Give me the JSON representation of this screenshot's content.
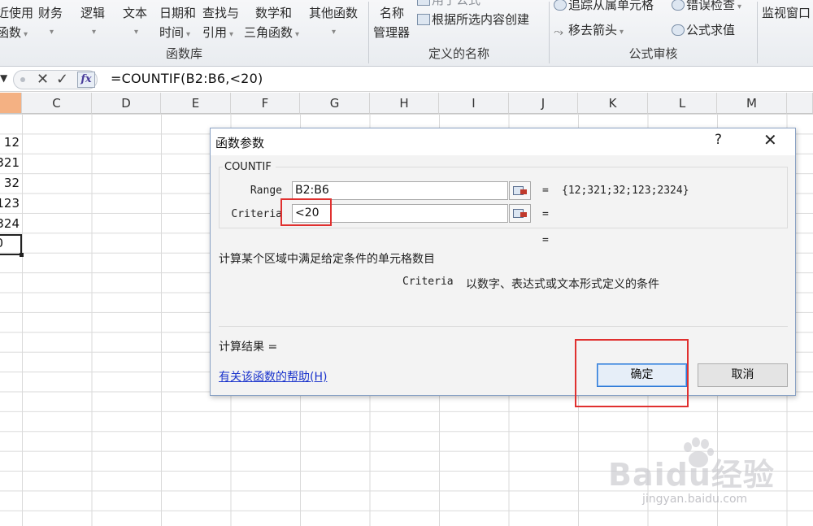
{
  "ribbon": {
    "groups": [
      {
        "label": "函数库"
      },
      {
        "label": "定义的名称"
      },
      {
        "label": "公式审核"
      }
    ],
    "items": {
      "recent_top": "近使用",
      "recent_bottom": "函数",
      "finance": "财务",
      "logic": "逻辑",
      "text": "文本",
      "datetime_top": "日期和",
      "datetime_bottom": "时间",
      "lookup_top": "查找与",
      "lookup_bottom": "引用",
      "math_top": "数学和",
      "math_bottom": "三角函数",
      "other": "其他函数",
      "name_manager_top": "名称",
      "name_manager_bottom": "管理器",
      "use_in_formula": "用于公式",
      "create_from_selection": "根据所选内容创建",
      "trace_dependents": "追踪从属单元格",
      "error_checking": "错误检查",
      "remove_arrows": "移去箭头",
      "evaluate_formula": "公式求值",
      "watch_window": "监视窗口"
    }
  },
  "formula_bar": {
    "formula": "=COUNTIF(B2:B6,<20)",
    "fx_label": "fx"
  },
  "columns": [
    "C",
    "D",
    "E",
    "F",
    "G",
    "H",
    "I",
    "J",
    "K",
    "L",
    "M"
  ],
  "partial_cells": [
    "12",
    "321",
    "32",
    "123",
    "324",
    "0"
  ],
  "dialog": {
    "title": "函数参数",
    "help_button": "?",
    "close_button": "✕",
    "function_name": "COUNTIF",
    "range_label": "Range",
    "range_value": "B2:B6",
    "range_result": "{12;321;32;123;2324}",
    "criteria_label": "Criteria",
    "criteria_value": "<20",
    "equals": "=",
    "description": "计算某个区域中满足给定条件的单元格数目",
    "param_name": "Criteria",
    "param_description": "以数字、表达式或文本形式定义的条件",
    "result_label": "计算结果 =",
    "help_link": "有关该函数的帮助(H)",
    "ok_button": "确定",
    "cancel_button": "取消"
  },
  "watermark": {
    "brand": "Baidu经验",
    "url": "jingyan.baidu.com"
  },
  "colors": {
    "annotation_red": "#e0302f",
    "link_blue": "#1a33cc",
    "selected_column": "#f4b183"
  }
}
